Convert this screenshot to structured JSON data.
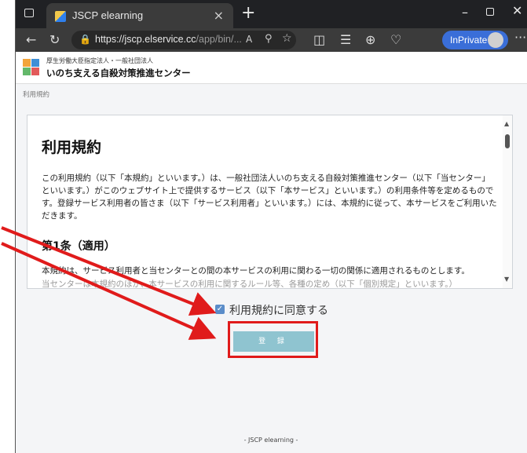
{
  "browser": {
    "tab_title": "JSCP elearning",
    "tab_close": "×",
    "new_tab": "+",
    "url_host": "https://jscp.elservice.cc",
    "url_path": "/app/bin/...",
    "inprivate_label": "InPrivate",
    "window_min": "–",
    "window_close": "✕"
  },
  "site": {
    "subtitle": "厚生労働大臣指定法人・一般社団法人",
    "title": "いのち支える自殺対策推進センター",
    "breadcrumb": "利用規約"
  },
  "document": {
    "title": "利用規約",
    "paragraph": "この利用規約（以下「本規約」といいます。）は、一般社団法人いのち支える自殺対策推進センター（以下「当センター」といいます。）がこのウェブサイト上で提供するサービス（以下「本サービス」といいます。）の利用条件等を定めるものです。登録サービス利用者の皆さま（以下「サービス利用者」といいます。）には、本規約に従って、本サービスをご利用いただきます。",
    "article_heading": "第1条（適用）",
    "article_text": "本規約は、サービス利用者と当センターとの間の本サービスの利用に関わる一切の関係に適用されるものとします。",
    "article_text_cut": "当センターは本規約のほか、本サービスの利用に関するルール等、各種の定め（以下「個別規定」といいます。）"
  },
  "form": {
    "agree_label": "利用規約に同意する",
    "agree_checked": true,
    "register_label": "登 録"
  },
  "footer": {
    "text": "- JSCP elearning -"
  },
  "colors": {
    "annotation_red": "#e01b1b",
    "button_teal": "#8fc4d0",
    "checkbox_blue": "#5b8dc9",
    "inprivate_blue": "#3a6ed8"
  }
}
